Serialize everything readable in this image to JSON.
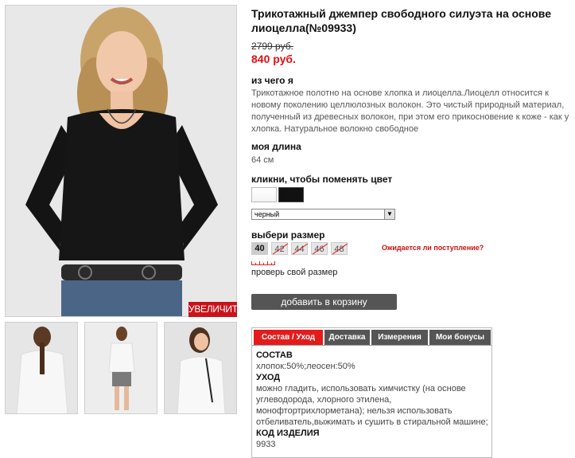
{
  "product": {
    "title": "Трикотажный джемпер свободного силуэта на основе лиоцелла(№09933)",
    "old_price": "2799 руб.",
    "new_price": "840 руб.",
    "zoom_label": "УВЕЛИЧИТЬ"
  },
  "material": {
    "heading": "из чего я",
    "text": "Трикотажное полотно на основе хлопка и лиоцелла.Лиоцелл относится к новому поколению целлюлозных волокон. Это чистый природный материал, полученный из древесных волокон, при этом его прикосновение к коже - как у хлопка. Натуральное волокно свободное"
  },
  "length": {
    "heading": "моя длина",
    "value": "64 см"
  },
  "color": {
    "heading": "кликни, чтобы поменять цвет",
    "selected": "черный",
    "swatches": [
      "white",
      "black"
    ]
  },
  "size": {
    "heading": "выбери размер",
    "options": [
      {
        "label": "40",
        "available": true
      },
      {
        "label": "42",
        "available": false
      },
      {
        "label": "44",
        "available": false
      },
      {
        "label": "46",
        "available": false
      },
      {
        "label": "48",
        "available": false
      }
    ],
    "waiting_link": "Ожидается ли поступление?",
    "check_link": "проверь свой размер"
  },
  "cart": {
    "button_label": "добавить в корзину"
  },
  "tabs": {
    "items": [
      "Состав / Уход",
      "Доставка",
      "Измерения",
      "Мои бонусы"
    ],
    "active": "Состав / Уход",
    "content": {
      "composition_heading": "СОСТАВ",
      "composition_text": "хлопок:50%;леосен:50%",
      "care_heading": "УХОД",
      "care_text": "можно гладить, использовать химчистку (на основе углеводорода, хлорного этилена, монофтортрихлорметана); нельзя использовать отбеливатель,выжимать и сушить в стиральной машине;",
      "code_heading": "КОД ИЗДЕЛИЯ",
      "code_value": "9933"
    }
  },
  "colors": {
    "accent_red": "#e51b1b",
    "tab_gray": "#555555"
  }
}
